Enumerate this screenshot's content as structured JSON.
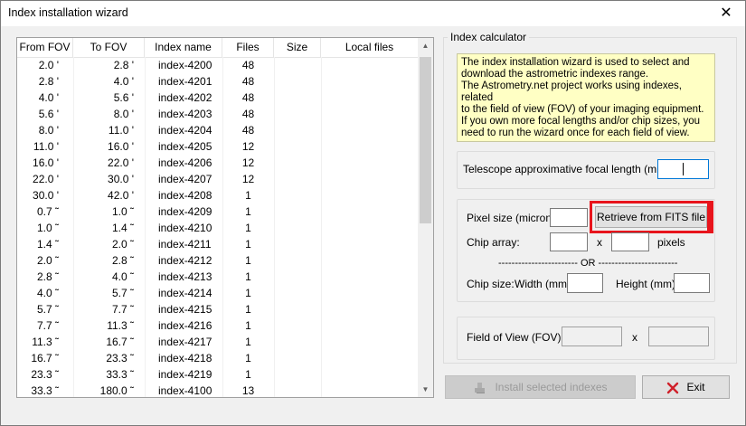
{
  "window": {
    "title": "Index installation wizard",
    "close_glyph": "✕"
  },
  "table": {
    "columns": {
      "from_fov": "From FOV",
      "to_fov": "To FOV",
      "index_name": "Index name",
      "files": "Files",
      "size": "Size",
      "local_files": "Local files"
    },
    "rows": [
      {
        "from": "2.0 '",
        "to": "2.8 '",
        "name": "index-4200",
        "files": "48"
      },
      {
        "from": "2.8 '",
        "to": "4.0 '",
        "name": "index-4201",
        "files": "48"
      },
      {
        "from": "4.0 '",
        "to": "5.6 '",
        "name": "index-4202",
        "files": "48"
      },
      {
        "from": "5.6 '",
        "to": "8.0 '",
        "name": "index-4203",
        "files": "48"
      },
      {
        "from": "8.0 '",
        "to": "11.0 '",
        "name": "index-4204",
        "files": "48"
      },
      {
        "from": "11.0 '",
        "to": "16.0 '",
        "name": "index-4205",
        "files": "12"
      },
      {
        "from": "16.0 '",
        "to": "22.0 '",
        "name": "index-4206",
        "files": "12"
      },
      {
        "from": "22.0 '",
        "to": "30.0 '",
        "name": "index-4207",
        "files": "12"
      },
      {
        "from": "30.0 '",
        "to": "42.0 '",
        "name": "index-4208",
        "files": "1"
      },
      {
        "from": "0.7 ˜",
        "to": "1.0 ˜",
        "name": "index-4209",
        "files": "1"
      },
      {
        "from": "1.0 ˜",
        "to": "1.4 ˜",
        "name": "index-4210",
        "files": "1"
      },
      {
        "from": "1.4 ˜",
        "to": "2.0 ˜",
        "name": "index-4211",
        "files": "1"
      },
      {
        "from": "2.0 ˜",
        "to": "2.8 ˜",
        "name": "index-4212",
        "files": "1"
      },
      {
        "from": "2.8 ˜",
        "to": "4.0 ˜",
        "name": "index-4213",
        "files": "1"
      },
      {
        "from": "4.0 ˜",
        "to": "5.7 ˜",
        "name": "index-4214",
        "files": "1"
      },
      {
        "from": "5.7 ˜",
        "to": "7.7 ˜",
        "name": "index-4215",
        "files": "1"
      },
      {
        "from": "7.7 ˜",
        "to": "11.3 ˜",
        "name": "index-4216",
        "files": "1"
      },
      {
        "from": "11.3 ˜",
        "to": "16.7 ˜",
        "name": "index-4217",
        "files": "1"
      },
      {
        "from": "16.7 ˜",
        "to": "23.3 ˜",
        "name": "index-4218",
        "files": "1"
      },
      {
        "from": "23.3 ˜",
        "to": "33.3 ˜",
        "name": "index-4219",
        "files": "1"
      },
      {
        "from": "33.3 ˜",
        "to": "180.0 ˜",
        "name": "index-4100",
        "files": "13"
      }
    ]
  },
  "calculator": {
    "group_label": "Index calculator",
    "info_lines": [
      "The index installation wizard is used to select and",
      "download the astrometric indexes range.",
      "The Astrometry.net project works using indexes, related",
      "to the field of view (FOV) of your imaging equipment.",
      "If you own more focal lengths and/or chip sizes, you",
      "need to run the wizard once for each field of view."
    ],
    "focal_label": "Telescope approximative focal length (mm)",
    "focal_value": "",
    "pixel_size_label": "Pixel size (micron)",
    "pixel_size_value": "",
    "retrieve_label": "Retrieve from FITS file",
    "chip_array_label": "Chip array:",
    "chip_x_value": "",
    "x_separator": "x",
    "pixels_label": "pixels",
    "or_separator": "------------------------ OR ------------------------",
    "chip_size_label": "Chip size:",
    "width_label": "Width (mm)",
    "width_value": "",
    "height_label": "Height (mm)",
    "height_value": "",
    "fov_label": "Field of View  (FOV)",
    "fov_x_separator": "x"
  },
  "buttons": {
    "install_label": "Install selected indexes",
    "exit_label": "Exit"
  },
  "colors": {
    "info_bg": "#ffffc4",
    "highlight": "#e8141c"
  }
}
